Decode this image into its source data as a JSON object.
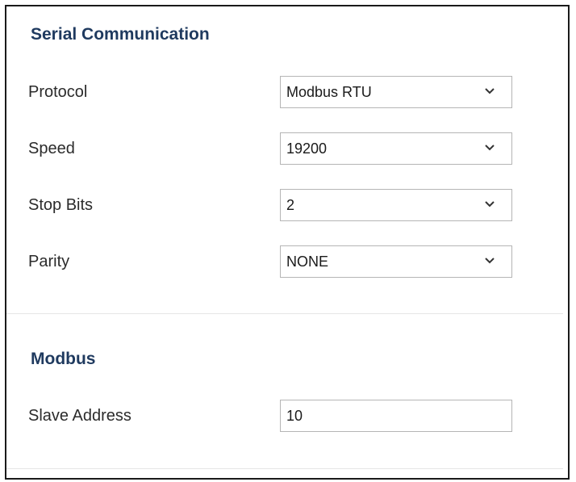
{
  "serial": {
    "title": "Serial Communication",
    "fields": [
      {
        "label": "Protocol",
        "value": "Modbus RTU"
      },
      {
        "label": "Speed",
        "value": "19200"
      },
      {
        "label": "Stop Bits",
        "value": "2"
      },
      {
        "label": "Parity",
        "value": "NONE"
      }
    ]
  },
  "modbus": {
    "title": "Modbus",
    "slave_address_label": "Slave Address",
    "slave_address_value": "10"
  },
  "icons": {
    "dropdown": "chevron-down-icon"
  },
  "colors": {
    "section_title": "#1f3a5f",
    "border": "#1a1a1a",
    "field_border": "#b5b5b5",
    "divider": "#e6e6e6"
  }
}
